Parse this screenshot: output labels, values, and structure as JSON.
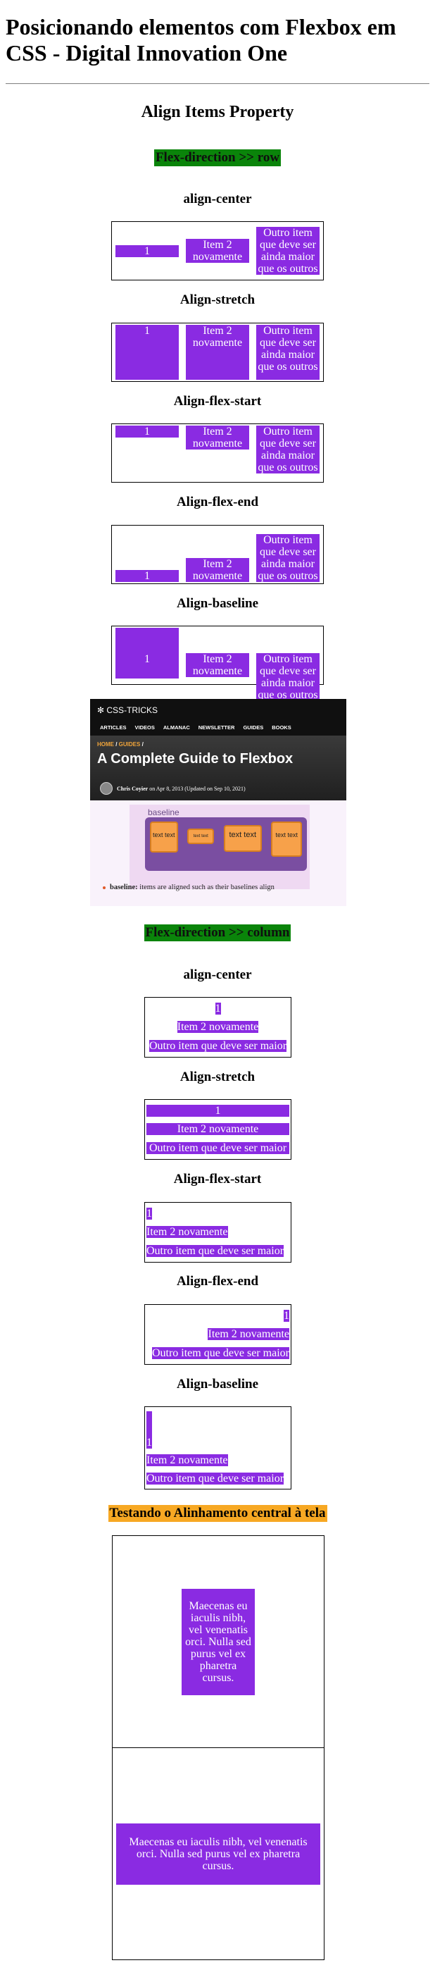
{
  "page": {
    "title": "Posicionando elementos com Flexbox em CSS - Digital Innovation One"
  },
  "section": {
    "heading": "Align Items Property"
  },
  "row": {
    "tag": "Flex-direction >> row",
    "cases": [
      {
        "label": "align-center"
      },
      {
        "label": "Align-stretch"
      },
      {
        "label": "Align-flex-start"
      },
      {
        "label": "Align-flex-end"
      },
      {
        "label": "Align-baseline"
      }
    ],
    "items": [
      "1",
      "Item 2 novamente",
      "Outro item que deve ser ainda maior que os outros"
    ]
  },
  "screenshot": {
    "logo": "✻ CSS-TRICKS",
    "nav": [
      "ARTICLES",
      "VIDEOS",
      "ALMANAC",
      "NEWSLETTER",
      "GUIDES",
      "BOOKS"
    ],
    "crumb_home": "HOME",
    "crumb_guides": "GUIDES",
    "guide_title": "A Complete Guide to Flexbox",
    "author": "Chris Coyier",
    "author_date": " on Apr 8, 2013 (Updated on Sep 10, 2021)",
    "demo_label": "baseline",
    "demo_items": [
      "text text",
      "text text",
      "text text",
      "text text"
    ],
    "note_term": "baseline:",
    "note_text": " items are aligned such as their baselines align"
  },
  "column": {
    "tag": "Flex-direction >> column",
    "cases": [
      {
        "label": "align-center"
      },
      {
        "label": "Align-stretch"
      },
      {
        "label": "Align-flex-start"
      },
      {
        "label": "Align-flex-end"
      },
      {
        "label": "Align-baseline"
      }
    ],
    "items": [
      "1",
      "Item 2 novamente",
      "Outro item que deve ser maior"
    ]
  },
  "centering": {
    "tag": "Testando o Alinhamento central à tela",
    "box1_text": "Maecenas eu iaculis nibh, vel venenatis orci. Nulla sed purus vel ex pharetra cursus.",
    "box2_text": "Maecenas eu iaculis nibh, vel venenatis orci. Nulla sed purus vel ex pharetra cursus."
  }
}
